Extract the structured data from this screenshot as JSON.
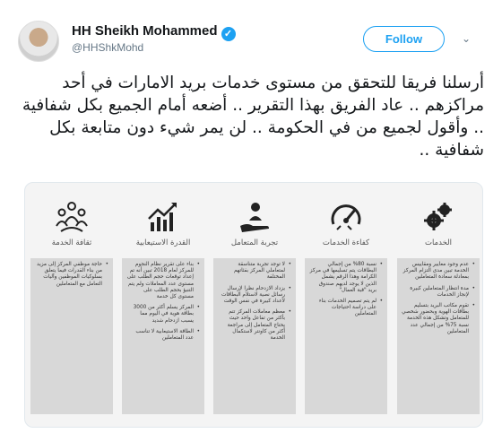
{
  "author": {
    "name": "HH Sheikh Mohammed",
    "handle": "@HHShkMohd",
    "verified": true
  },
  "follow_label": "Follow",
  "tweet_text": "أرسلنا فريقا للتحقق من مستوى خدمات بريد الامارات في أحد مراكزهم .. عاد الفريق بهذا التقرير .. أضعه أمام الجميع بكل شفافية .. وأقول لجميع من في الحكومة .. لن يمر شيء دون متابعة بكل شفافية ..",
  "icons": {
    "follow_caret": "chevron-down-icon",
    "verified": "verified-badge-icon"
  },
  "colors": {
    "accent": "#1da1f2",
    "text": "#14171a",
    "muted": "#657786"
  },
  "report": {
    "columns": [
      {
        "title": "الخدمات",
        "icon": "gears-icon",
        "bullets": [
          "عدم وجود معايير ومقاييس الخدمة تبين مدى التزام المركز بمعادلة سعادة المتعاملين",
          "مدة انتظار المتعاملين كبيرة لإنجاز الخدمات",
          "تقوم مكاتب البريد بتسليم بطاقات الهوية وبحضور شخصي للمتعامل وتشكل هذه الخدمة نسبة 75% من إجمالي عدد المتعاملين"
        ]
      },
      {
        "title": "كفاءة الخدمات",
        "icon": "speedometer-icon",
        "bullets": [
          "نسبة 80% من إجمالي البطاقات يتم تسليمها في مركز الكرامة وهذا الرقم يشمل الذين لا يوجد لديهم صندوق بريد \"قبة العمال\"",
          "لم يتم تصميم الخدمات بناء على دراسة احتياجات المتعاملين"
        ]
      },
      {
        "title": "تجربة المتعامل",
        "icon": "hand-person-icon",
        "bullets": [
          "لا توجد تجربة متناسقة لمتعاملي المركز بفئاتهم المختلفة",
          "يزداد الازدحام نظرا لإرسال رسائل نصية لاستلام البطاقات لأعداد كبيرة في نفس الوقت",
          "معظم معاملات المركز تتم بأكثر من تفاعل واحد حيث يحتاج المتعامل إلى مراجعة أكثر من كاونتر لاستكمال الخدمة"
        ]
      },
      {
        "title": "القدرة الاستيعابية",
        "icon": "bar-chart-growth-icon",
        "bullets": [
          "بناء على تقرير نظام النجوم للمركز لعام 2018 تبين أنه تم إعداد توقعات حجم الطلب على مستوى عدد المعاملات ولم يتم التنبؤ بحجم الطلب على مستوى كل خدمة",
          "المركز يسلم أكثر من 3000 بطاقة هوية في اليوم مما يسبب ازدحام شديد",
          "الطاقة الاستيعابية لا تناسب عدد المتعاملين"
        ]
      },
      {
        "title": "ثقافة الخدمة",
        "icon": "people-group-icon",
        "bullets": [
          "حاجة موظفي المركز إلى مزيد من بناء القدرات فيما يتعلق بسلوكيات الموظفين وآليات التعامل مع المتعاملين"
        ]
      }
    ]
  }
}
